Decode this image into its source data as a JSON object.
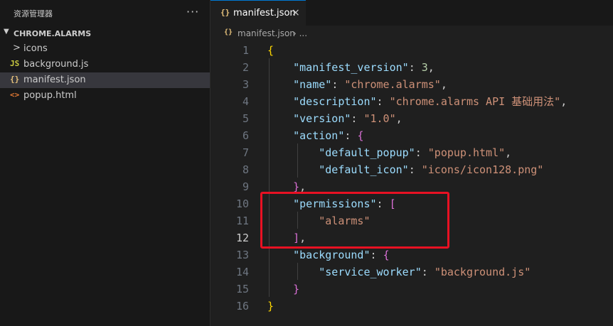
{
  "explorer": {
    "title": "资源管理器",
    "more_icon": "···",
    "folder": "CHROME.ALARMS",
    "items": [
      {
        "label": "icons",
        "icon": ">",
        "icon_name": "chevron-right-icon",
        "type": "folder"
      },
      {
        "label": "background.js",
        "icon": "JS",
        "icon_name": "javascript-file-icon",
        "type": "file"
      },
      {
        "label": "manifest.json",
        "icon": "{}",
        "icon_name": "json-file-icon",
        "type": "file",
        "selected": true
      },
      {
        "label": "popup.html",
        "icon": "<>",
        "icon_name": "html-file-icon",
        "type": "file"
      }
    ]
  },
  "editor": {
    "tab": {
      "label": "manifest.json",
      "icon": "{}",
      "close": "×"
    },
    "breadcrumb": {
      "icon": "{}",
      "file": "manifest.json",
      "sep": "› ..."
    },
    "active_line": 12,
    "lines": [
      {
        "n": "1",
        "tokens": [
          {
            "t": "{",
            "c": "b1"
          }
        ]
      },
      {
        "n": "2",
        "tokens": [
          {
            "t": "    ",
            "c": ""
          },
          {
            "t": "\"manifest_version\"",
            "c": "key"
          },
          {
            "t": ": ",
            "c": ""
          },
          {
            "t": "3",
            "c": "num"
          },
          {
            "t": ",",
            "c": ""
          }
        ]
      },
      {
        "n": "3",
        "tokens": [
          {
            "t": "    ",
            "c": ""
          },
          {
            "t": "\"name\"",
            "c": "key"
          },
          {
            "t": ": ",
            "c": ""
          },
          {
            "t": "\"chrome.alarms\"",
            "c": "str"
          },
          {
            "t": ",",
            "c": ""
          }
        ]
      },
      {
        "n": "4",
        "tokens": [
          {
            "t": "    ",
            "c": ""
          },
          {
            "t": "\"description\"",
            "c": "key"
          },
          {
            "t": ": ",
            "c": ""
          },
          {
            "t": "\"chrome.alarms API 基础用法\"",
            "c": "str"
          },
          {
            "t": ",",
            "c": ""
          }
        ]
      },
      {
        "n": "5",
        "tokens": [
          {
            "t": "    ",
            "c": ""
          },
          {
            "t": "\"version\"",
            "c": "key"
          },
          {
            "t": ": ",
            "c": ""
          },
          {
            "t": "\"1.0\"",
            "c": "str"
          },
          {
            "t": ",",
            "c": ""
          }
        ]
      },
      {
        "n": "6",
        "tokens": [
          {
            "t": "    ",
            "c": ""
          },
          {
            "t": "\"action\"",
            "c": "key"
          },
          {
            "t": ": ",
            "c": ""
          },
          {
            "t": "{",
            "c": "b2"
          }
        ]
      },
      {
        "n": "7",
        "tokens": [
          {
            "t": "        ",
            "c": ""
          },
          {
            "t": "\"default_popup\"",
            "c": "key"
          },
          {
            "t": ": ",
            "c": ""
          },
          {
            "t": "\"popup.html\"",
            "c": "str"
          },
          {
            "t": ",",
            "c": ""
          }
        ]
      },
      {
        "n": "8",
        "tokens": [
          {
            "t": "        ",
            "c": ""
          },
          {
            "t": "\"default_icon\"",
            "c": "key"
          },
          {
            "t": ": ",
            "c": ""
          },
          {
            "t": "\"icons/icon128.png\"",
            "c": "str"
          }
        ]
      },
      {
        "n": "9",
        "tokens": [
          {
            "t": "    ",
            "c": ""
          },
          {
            "t": "}",
            "c": "b2"
          },
          {
            "t": ",",
            "c": ""
          }
        ]
      },
      {
        "n": "10",
        "tokens": [
          {
            "t": "    ",
            "c": ""
          },
          {
            "t": "\"permissions\"",
            "c": "key"
          },
          {
            "t": ": ",
            "c": ""
          },
          {
            "t": "[",
            "c": "b2"
          }
        ]
      },
      {
        "n": "11",
        "tokens": [
          {
            "t": "        ",
            "c": ""
          },
          {
            "t": "\"alarms\"",
            "c": "str"
          }
        ]
      },
      {
        "n": "12",
        "tokens": [
          {
            "t": "    ",
            "c": ""
          },
          {
            "t": "]",
            "c": "b2"
          },
          {
            "t": ",",
            "c": ""
          }
        ]
      },
      {
        "n": "13",
        "tokens": [
          {
            "t": "    ",
            "c": ""
          },
          {
            "t": "\"background\"",
            "c": "key"
          },
          {
            "t": ": ",
            "c": ""
          },
          {
            "t": "{",
            "c": "b2"
          }
        ]
      },
      {
        "n": "14",
        "tokens": [
          {
            "t": "        ",
            "c": ""
          },
          {
            "t": "\"service_worker\"",
            "c": "key"
          },
          {
            "t": ": ",
            "c": ""
          },
          {
            "t": "\"background.js\"",
            "c": "str"
          }
        ]
      },
      {
        "n": "15",
        "tokens": [
          {
            "t": "    ",
            "c": ""
          },
          {
            "t": "}",
            "c": "b2"
          }
        ]
      },
      {
        "n": "16",
        "tokens": [
          {
            "t": "}",
            "c": "b1"
          }
        ]
      }
    ]
  },
  "colors": {
    "highlight_box": "#e81123",
    "accent": "#0078d4"
  }
}
